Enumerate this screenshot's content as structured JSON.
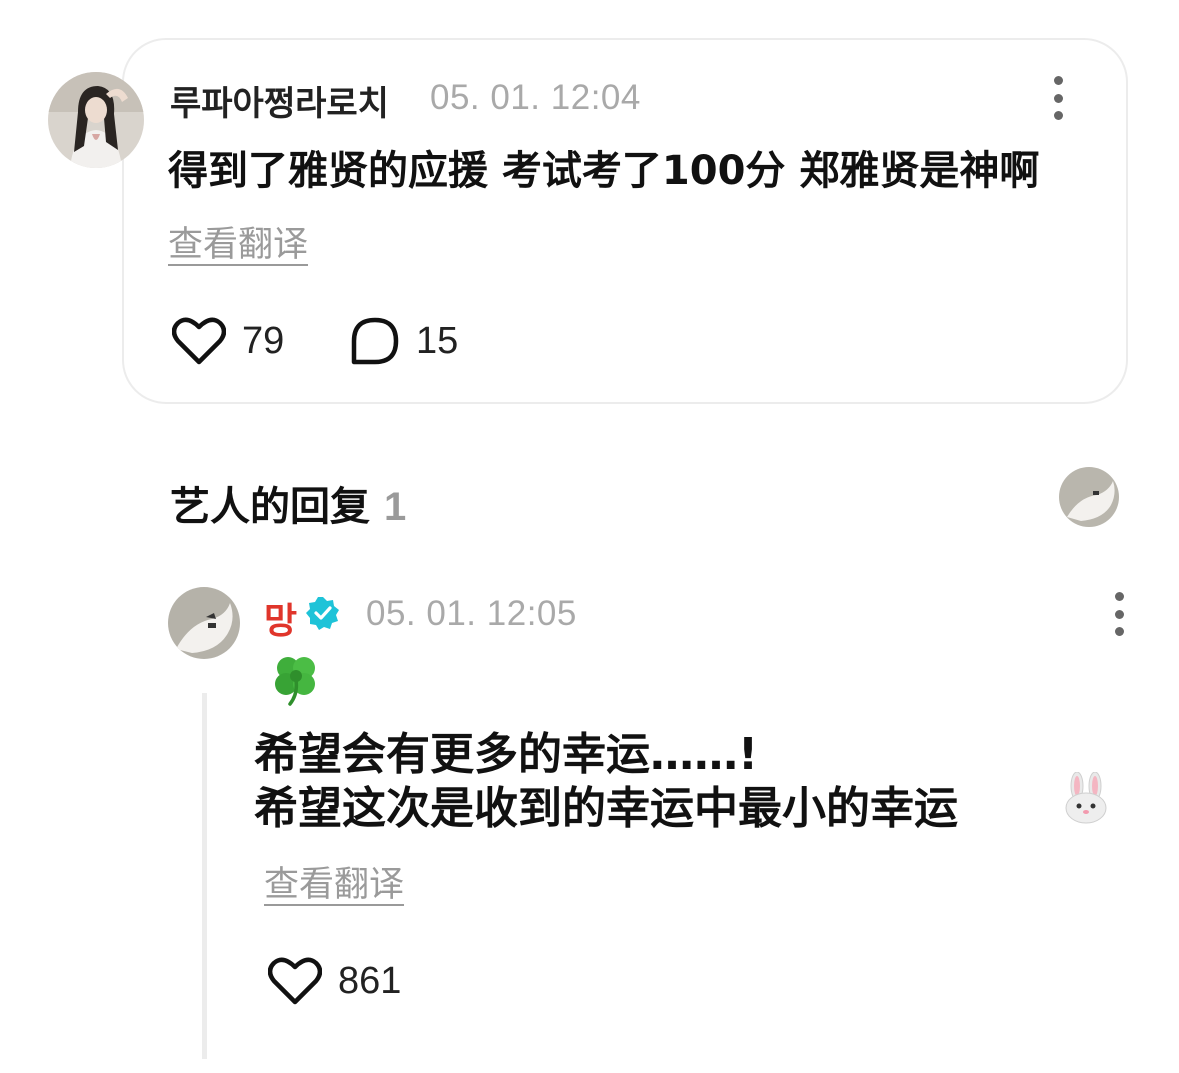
{
  "post": {
    "username": "루파아쩡라로치",
    "timestamp": "05. 01. 12:04",
    "text": "得到了雅贤的应援 考试考了100分 郑雅贤是神啊",
    "translate_label": "查看翻译",
    "likes": "79",
    "comments": "15",
    "icons": {
      "avatar": "user-avatar-icon",
      "more": "more-vertical-icon",
      "like": "heart-icon",
      "comment": "comment-bubble-icon"
    }
  },
  "artist_replies": {
    "title": "艺人的回复",
    "count": "1"
  },
  "reply": {
    "username": "망",
    "timestamp": "05. 01. 12:05",
    "emoji": "🍀",
    "line1": "希望会有更多的幸运……!",
    "line2": "希望这次是收到的幸运中最小的幸运",
    "trailing_emoji": "🐰",
    "translate_label": "查看翻译",
    "likes": "861",
    "icons": {
      "verified": "verified-badge-icon",
      "more": "more-vertical-icon",
      "like": "heart-icon"
    }
  },
  "colors": {
    "artist_name": "#e0352b",
    "verified_badge": "#1ec3d8",
    "muted_text": "#a9a9a9",
    "card_border": "#ececec"
  }
}
